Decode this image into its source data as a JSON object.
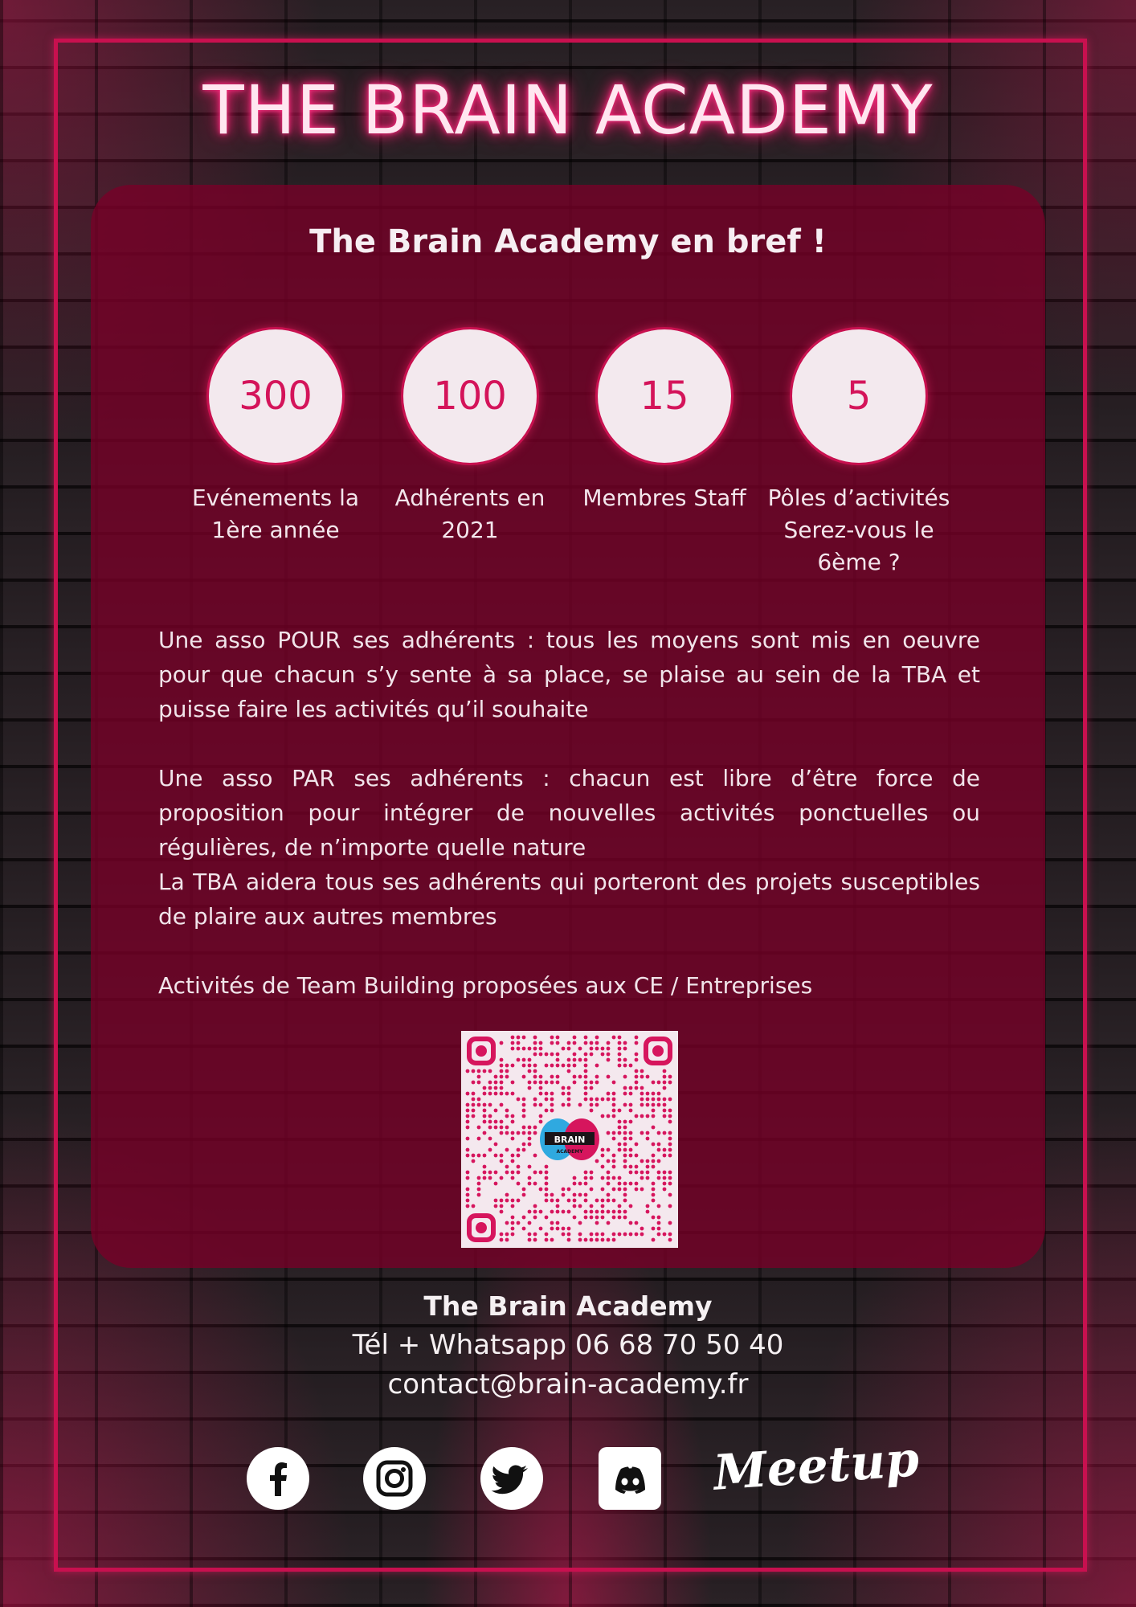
{
  "title": "THE BRAIN ACADEMY",
  "panel": {
    "heading": "The Brain Academy en bref !",
    "stats": [
      {
        "value": "300",
        "label_line1": "Evénements la",
        "label_line2": "1ère année",
        "label_line3": ""
      },
      {
        "value": "100",
        "label_line1": "Adhérents en",
        "label_line2": "2021",
        "label_line3": ""
      },
      {
        "value": "15",
        "label_line1": "Membres Staff",
        "label_line2": "",
        "label_line3": ""
      },
      {
        "value": "5",
        "label_line1": "Pôles d’activités",
        "label_line2": "Serez-vous le",
        "label_line3": "6ème ?"
      }
    ],
    "paragraphs": {
      "p1": "Une asso POUR ses adhérents : tous les moyens sont mis en oeuvre pour que chacun s’y sente à sa place, se plaise au sein de la TBA et puisse faire les activités qu’il souhaite",
      "p2": "Une asso PAR ses adhérents : chacun est libre d’être force de proposition pour intégrer de nouvelles activités ponctuelles ou régulières, de n’importe quelle nature",
      "p3": "La TBA aidera tous ses adhérents qui porteront des projets susceptibles de plaire aux autres membres",
      "p4": "Activités de Team Building proposées aux CE / Entreprises"
    },
    "qr_logo_text": "BRAIN",
    "qr_logo_sub": "ACADEMY"
  },
  "contact": {
    "name": "The Brain Academy",
    "tel": "Tél + Whatsapp 06 68 70 50 40",
    "email": "contact@brain-academy.fr"
  },
  "social": {
    "icons": [
      "facebook-icon",
      "instagram-icon",
      "twitter-icon",
      "discord-icon",
      "meetup-logo"
    ],
    "meetup_text": "Meetup"
  },
  "colors": {
    "accent": "#c8104f",
    "panel": "#78002a",
    "circle_text": "#d4145a"
  }
}
